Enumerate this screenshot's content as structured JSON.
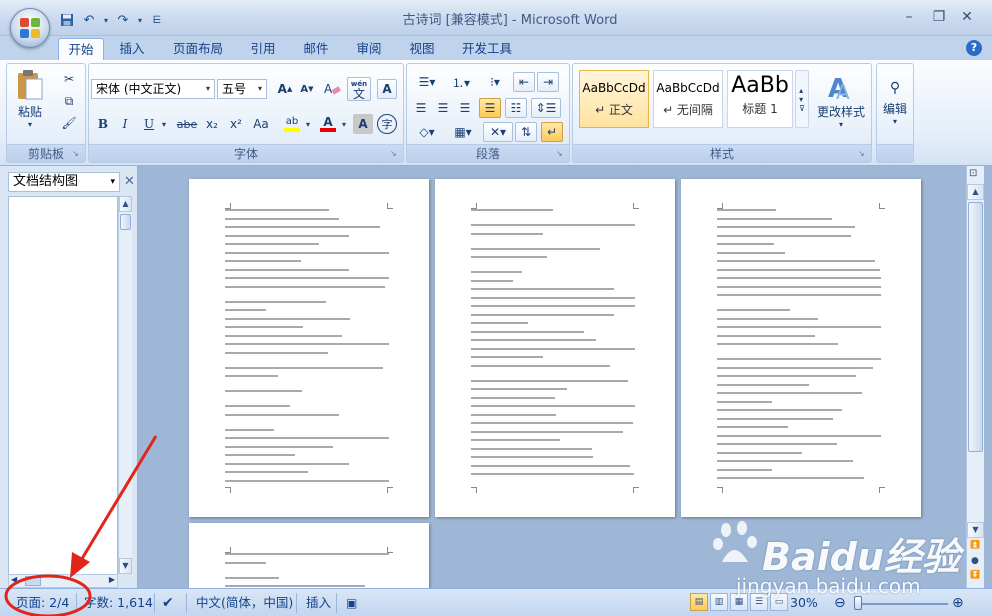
{
  "window": {
    "title": "古诗词 [兼容模式] - Microsoft Word",
    "quick_access": [
      "save-icon",
      "undo-icon",
      "redo-icon",
      "customize-icon"
    ],
    "controls": [
      "minimize-icon",
      "restore-icon",
      "close-icon"
    ]
  },
  "tabs": [
    {
      "label": "开始",
      "active": true
    },
    {
      "label": "插入"
    },
    {
      "label": "页面布局"
    },
    {
      "label": "引用"
    },
    {
      "label": "邮件"
    },
    {
      "label": "审阅"
    },
    {
      "label": "视图"
    },
    {
      "label": "开发工具"
    }
  ],
  "ribbon": {
    "clipboard": {
      "label": "剪贴板",
      "paste": "粘贴"
    },
    "font": {
      "label": "字体",
      "font_name": "宋体 (中文正文)",
      "font_size": "五号",
      "buttons": [
        "B",
        "I",
        "U",
        "abe",
        "x₂",
        "x²",
        "Aa"
      ],
      "wen": "wén",
      "wen_char": "文",
      "border_char": "A",
      "highlight_letter": "ab",
      "font_color_letter": "A",
      "char_shading": "A",
      "enclose_char": "字"
    },
    "paragraph": {
      "label": "段落"
    },
    "styles": {
      "label": "样式",
      "tiles": [
        {
          "sample": "AaBbCcDd",
          "name": "↵ 正文",
          "selected": true
        },
        {
          "sample": "AaBbCcDd",
          "name": "↵ 无间隔"
        },
        {
          "sample": "AaBb",
          "name": "标题 1"
        }
      ],
      "change_styles": "更改样式"
    },
    "editing": {
      "label": "编辑"
    }
  },
  "doc_map": {
    "title": "文档结构图"
  },
  "status": {
    "page": "页面: 2/4",
    "words": "字数: 1,614",
    "language": "中文(简体，中国)",
    "mode": "插入",
    "zoom": "30%"
  },
  "watermark": {
    "brand": "Baidu经验",
    "site": "jingyan.baidu.com"
  }
}
